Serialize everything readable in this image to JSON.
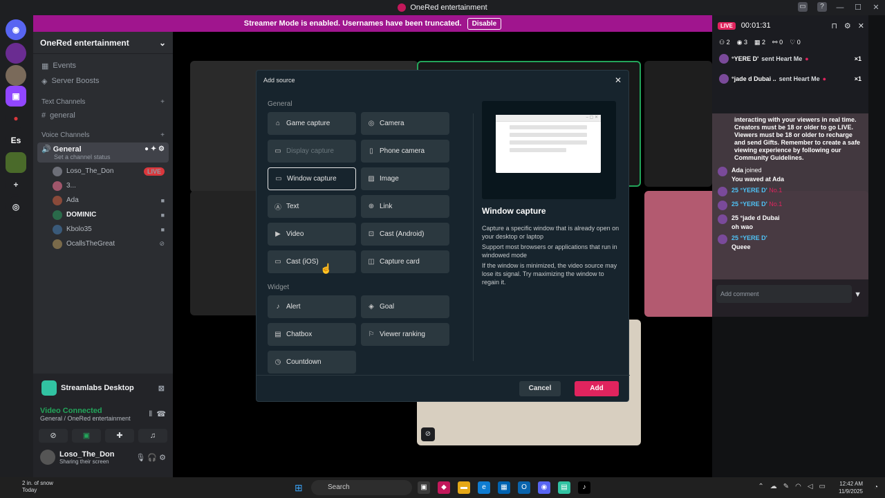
{
  "window": {
    "title": "OneRed entertainment"
  },
  "banner": {
    "text": "Streamer Mode is enabled. Usernames have been truncated.",
    "button": "Disable"
  },
  "server": {
    "name": "OneRed entertainment",
    "nav": [
      {
        "label": "Events",
        "icon": "calendar-icon"
      },
      {
        "label": "Server Boosts",
        "icon": "boost-icon"
      }
    ],
    "text_category": "Text Channels",
    "text_channels": [
      "general"
    ],
    "voice_category": "Voice Channels",
    "voice_channel": {
      "name": "General",
      "status_placeholder": "Set a channel status"
    },
    "members": [
      {
        "name": "Loso_The_Don",
        "badge": "LIVE"
      },
      {
        "name": "3..."
      },
      {
        "name": "Ada"
      },
      {
        "name": "DOMINIC"
      },
      {
        "name": "Kbolo35"
      },
      {
        "name": "OcallsTheGreat"
      }
    ]
  },
  "rail": [
    "Es"
  ],
  "rtc": {
    "activity": "Streamlabs Desktop",
    "status": "Video Connected",
    "channel": "General / OneRed entertainment"
  },
  "user": {
    "name": "Loso_The_Don",
    "status": "Sharing their screen"
  },
  "modal": {
    "title": "Add source",
    "general_label": "General",
    "widget_label": "Widget",
    "general_sources": [
      {
        "label": "Game capture",
        "icon": "gamepad-icon"
      },
      {
        "label": "Camera",
        "icon": "camera-icon"
      },
      {
        "label": "Display capture",
        "icon": "monitor-icon",
        "disabled": true
      },
      {
        "label": "Phone camera",
        "icon": "phone-icon"
      },
      {
        "label": "Window capture",
        "icon": "window-icon",
        "selected": true
      },
      {
        "label": "Image",
        "icon": "image-icon"
      },
      {
        "label": "Text",
        "icon": "text-icon"
      },
      {
        "label": "Link",
        "icon": "globe-icon"
      },
      {
        "label": "Video",
        "icon": "play-icon"
      },
      {
        "label": "Cast (Android)",
        "icon": "cast-icon"
      },
      {
        "label": "Cast (iOS)",
        "icon": "cast-ios-icon"
      },
      {
        "label": "Capture card",
        "icon": "capture-card-icon"
      }
    ],
    "widget_sources": [
      {
        "label": "Alert",
        "icon": "bell-icon"
      },
      {
        "label": "Goal",
        "icon": "shield-icon"
      },
      {
        "label": "Chatbox",
        "icon": "chat-icon"
      },
      {
        "label": "Viewer ranking",
        "icon": "ranking-icon"
      },
      {
        "label": "Countdown",
        "icon": "timer-icon"
      }
    ],
    "detail": {
      "title": "Window capture",
      "p1": "Capture a specific window that is already open on your desktop or laptop",
      "p2": "Support most browsers or applications that run in windowed mode",
      "p3": "If the window is minimized, the video source may lose its signal. Try maximizing the window to regain it."
    },
    "cancel": "Cancel",
    "add": "Add"
  },
  "live": {
    "badge": "LIVE",
    "timer": "00:01:31",
    "stats": [
      "2",
      "3",
      "2",
      "0",
      "0"
    ],
    "gifts": [
      {
        "user": "°YERE D'",
        "action": "sent Heart Me",
        "count": "×1"
      },
      {
        "user": "°jade d Dubai ..",
        "action": "sent Heart Me",
        "count": "×1"
      }
    ],
    "system": "interacting with your viewers in real time. Creators must be 18 or older to go LIVE. Viewers must be 18 or older to recharge and send Gifts. Remember to create a safe viewing experience by following our Community Guidelines.",
    "messages": [
      {
        "name": "Ada",
        "text": "joined",
        "sub": "You waved at Ada"
      },
      {
        "name": "25 °YERE D'",
        "text": "No.1"
      },
      {
        "name": "25 °YERE D'",
        "text": "No.1"
      },
      {
        "name": "25 °jade d Dubai",
        "text": "oh wao"
      },
      {
        "name": "25 °YERE D'",
        "text": "Queee"
      }
    ],
    "comment_placeholder": "Add comment"
  },
  "taskbar": {
    "weather_line1": "2 in. of snow",
    "weather_line2": "Today",
    "search": "Search",
    "time": "12:42 AM",
    "date": "11/9/2025"
  },
  "colors": {
    "accent": "#e0245e",
    "banner": "#a0158e",
    "modal_bg": "#17242d"
  }
}
